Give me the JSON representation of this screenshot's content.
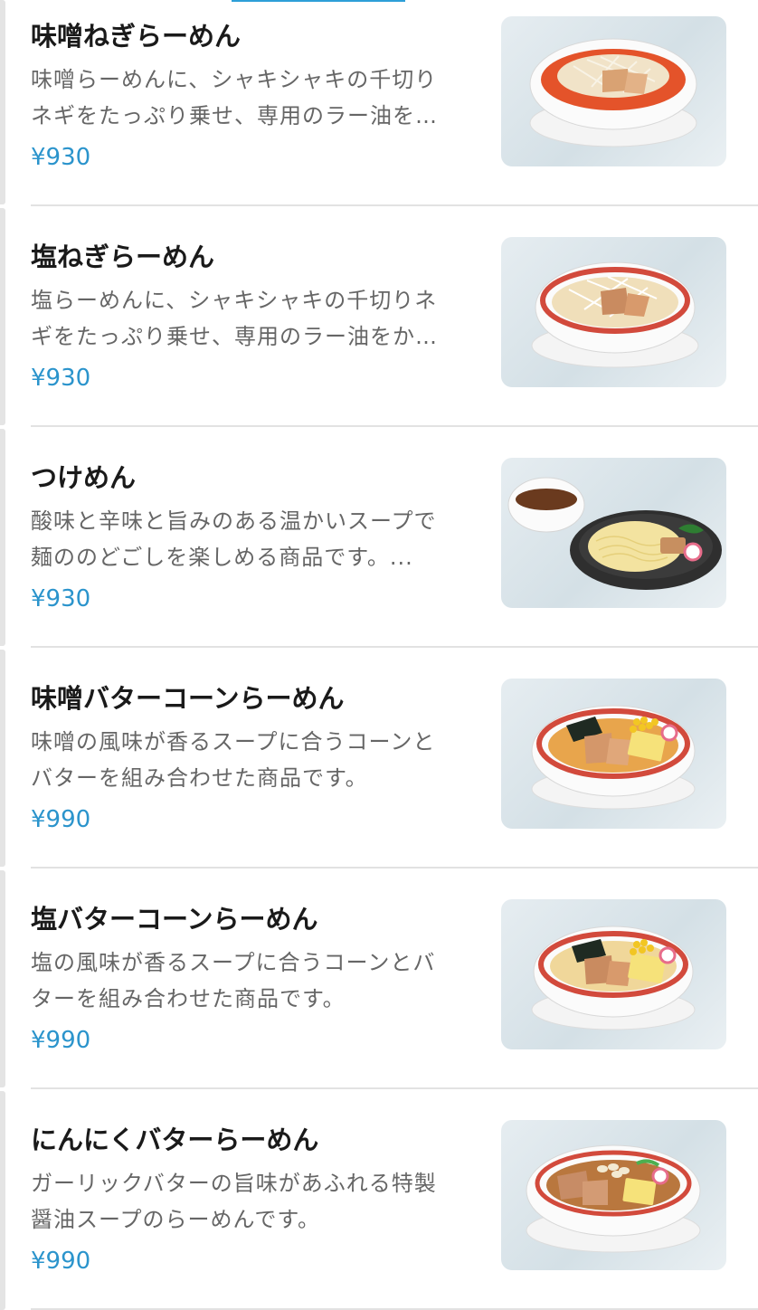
{
  "menu": {
    "items": [
      {
        "name": "味噌ねぎらーめん",
        "desc_line1": "味噌らーめんに、シャキシャキの千切り",
        "desc_line2": "ネギをたっぷり乗せ、専用のラー油を…",
        "price": "¥930",
        "photo_icon": "miso-negi-ramen-photo"
      },
      {
        "name": "塩ねぎらーめん",
        "desc_line1": "塩らーめんに、シャキシャキの千切りネ",
        "desc_line2": "ギをたっぷり乗せ、専用のラー油をか…",
        "price": "¥930",
        "photo_icon": "shio-negi-ramen-photo"
      },
      {
        "name": "つけめん",
        "desc_line1": "酸味と辛味と旨みのある温かいスープで",
        "desc_line2": "麺ののどごしを楽しめる商品です。...",
        "price": "¥930",
        "photo_icon": "tsukemen-photo"
      },
      {
        "name": "味噌バターコーンらーめん",
        "desc_line1": "味噌の風味が香るスープに合うコーンと",
        "desc_line2": "バターを組み合わせた商品です。",
        "price": "¥990",
        "photo_icon": "miso-butter-corn-ramen-photo"
      },
      {
        "name": "塩バターコーンらーめん",
        "desc_line1": "塩の風味が香るスープに合うコーンとバ",
        "desc_line2": "ターを組み合わせた商品です。",
        "price": "¥990",
        "photo_icon": "shio-butter-corn-ramen-photo"
      },
      {
        "name": "にんにくバターらーめん",
        "desc_line1": "ガーリックバターの旨味があふれる特製",
        "desc_line2": "醤油スープのらーめんです。",
        "price": "¥990",
        "photo_icon": "garlic-butter-ramen-photo"
      }
    ]
  },
  "colors": {
    "accent": "#2d9fd8",
    "price": "#2b94cc",
    "title": "#1a1a1a",
    "description": "#666666",
    "divider": "#e2e2e2"
  }
}
